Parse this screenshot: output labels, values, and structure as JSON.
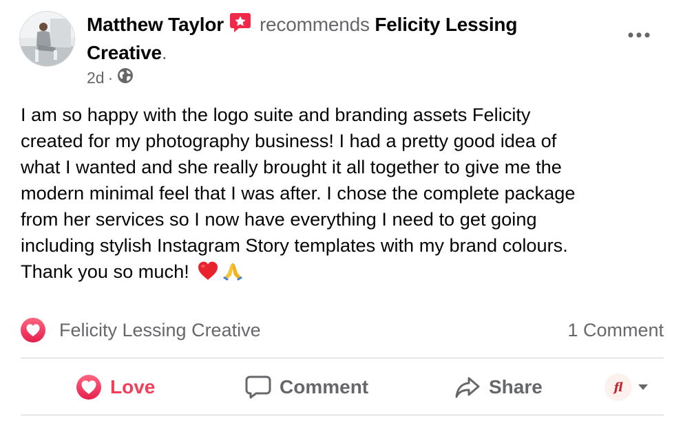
{
  "post": {
    "author": "Matthew Taylor",
    "recommends_word": "recommends",
    "page_name": "Felicity Lessing Creative",
    "period": ".",
    "time": "2d",
    "separator": "·",
    "icons": {
      "recommend_badge": "recommend-star-icon",
      "privacy": "globe-icon",
      "more": "more-horizontal-icon"
    },
    "body_lines": [
      "I am so happy with the logo suite and branding assets Felicity",
      "created for my photography business! I had a pretty good idea of",
      "what I wanted and she really brought it all together to give me the",
      "modern minimal feel that I was after. I chose the complete package",
      "from her services so I now have everything I need to get going",
      "including stylish Instagram Story templates with my brand colours.",
      "Thank you so much!"
    ],
    "body_emoji": [
      "red-heart-emoji",
      "folded-hands-emoji"
    ]
  },
  "reactions": {
    "reactor_name": "Felicity Lessing Creative",
    "reaction_icon": "love-reaction-icon",
    "comment_count": "1 Comment"
  },
  "actions": {
    "love_label": "Love",
    "comment_label": "Comment",
    "share_label": "Share",
    "page_logo_text": "fl"
  },
  "colors": {
    "love": "#f33e58",
    "secondary_text": "#65676b",
    "primary_text": "#050505",
    "divider": "#ced0d4",
    "recommend_badge": "#f02849"
  }
}
